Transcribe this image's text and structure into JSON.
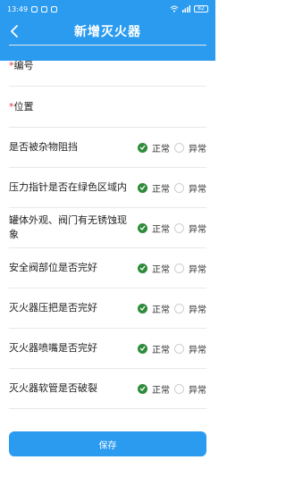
{
  "status_bar": {
    "time": "13:49",
    "battery": "82"
  },
  "header": {
    "title": "新增灭火器"
  },
  "form": {
    "fields": [
      {
        "required_mark": "*",
        "label": "编号",
        "value": ""
      },
      {
        "required_mark": "*",
        "label": "位置",
        "value": ""
      }
    ],
    "checks": [
      {
        "label": "是否被杂物阻挡",
        "options": [
          "正常",
          "异常"
        ],
        "selected": "正常"
      },
      {
        "label": "压力指针是否在绿色区域内",
        "options": [
          "正常",
          "异常"
        ],
        "selected": "正常"
      },
      {
        "label": "罐体外观、阀门有无锈蚀现象",
        "options": [
          "正常",
          "异常"
        ],
        "selected": "正常"
      },
      {
        "label": "安全阀部位是否完好",
        "options": [
          "正常",
          "异常"
        ],
        "selected": "正常"
      },
      {
        "label": "灭火器压把是否完好",
        "options": [
          "正常",
          "异常"
        ],
        "selected": "正常"
      },
      {
        "label": "灭火器喷嘴是否完好",
        "options": [
          "正常",
          "异常"
        ],
        "selected": "正常"
      },
      {
        "label": "灭火器软管是否破裂",
        "options": [
          "正常",
          "异常"
        ],
        "selected": "正常"
      }
    ]
  },
  "actions": {
    "save_label": "保存"
  },
  "colors": {
    "primary": "#2b9bf0",
    "checked": "#2e8b3a",
    "required": "#e53935"
  },
  "icons": {
    "back": "chevron-left-icon",
    "checked": "check-circle-icon"
  }
}
